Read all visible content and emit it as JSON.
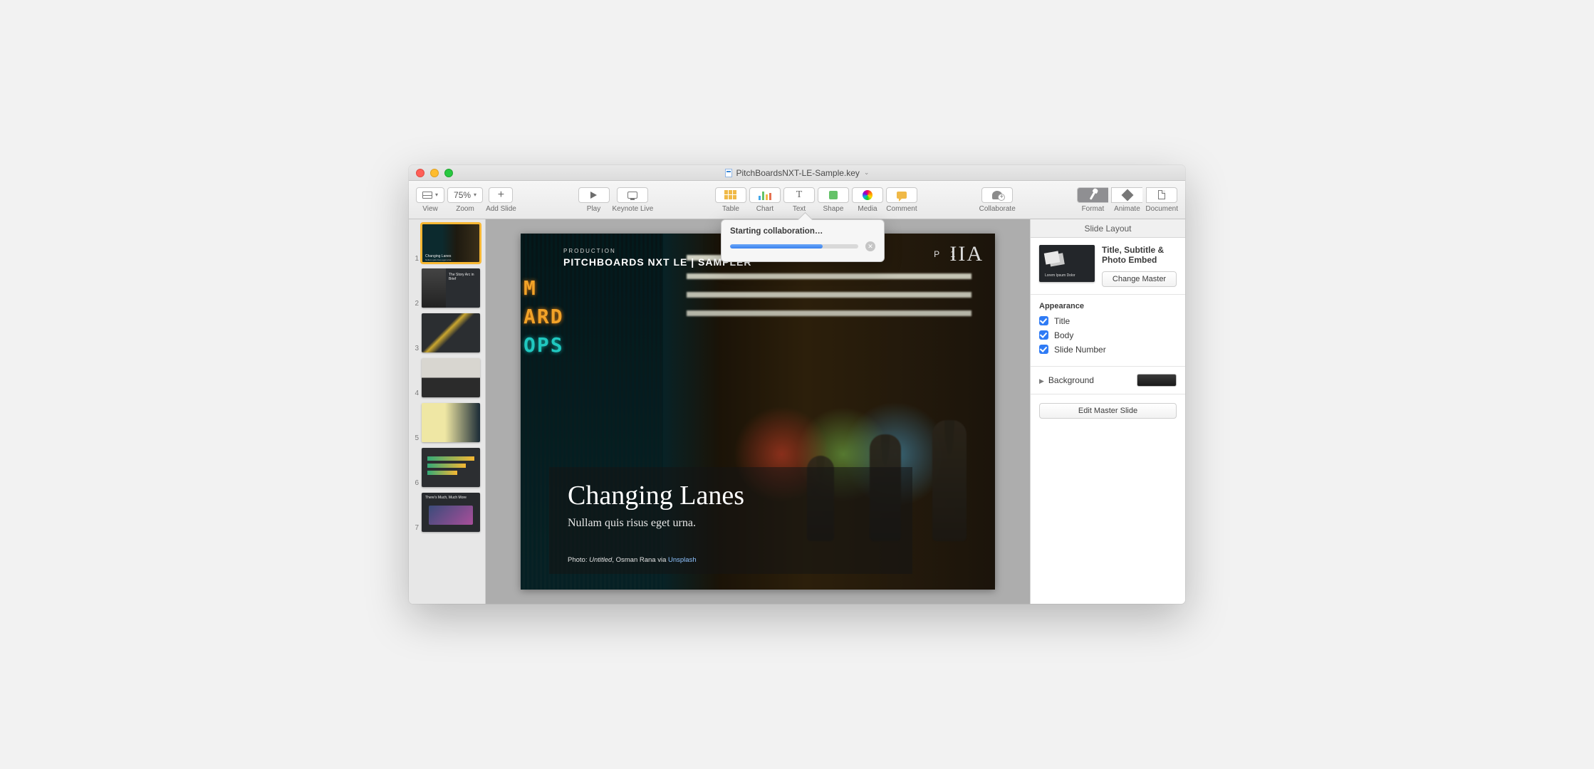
{
  "window": {
    "title": "PitchBoardsNXT-LE-Sample.key"
  },
  "toolbar": {
    "view": "View",
    "zoom_value": "75%",
    "zoom": "Zoom",
    "add_slide": "Add Slide",
    "play": "Play",
    "keynote_live": "Keynote Live",
    "table": "Table",
    "chart": "Chart",
    "text": "Text",
    "shape": "Shape",
    "media": "Media",
    "comment": "Comment",
    "collaborate": "Collaborate",
    "format": "Format",
    "animate": "Animate",
    "document": "Document"
  },
  "thumbnails": [
    {
      "n": "1",
      "title": "Changing Lanes",
      "sub": "Nullam quis risus eget urna"
    },
    {
      "n": "2",
      "title": "The Story Arc in Brief",
      "sub": ""
    },
    {
      "n": "3",
      "title": "",
      "sub": ""
    },
    {
      "n": "4",
      "title": "",
      "sub": ""
    },
    {
      "n": "5",
      "title": "",
      "sub": ""
    },
    {
      "n": "6",
      "title": "",
      "sub": ""
    },
    {
      "n": "7",
      "title": "There's Much, Much More",
      "sub": ""
    }
  ],
  "slide": {
    "overline": "PRODUCTION",
    "banner": "PITCHBOARDS NXT LE | SAMPLER",
    "page_prefix": "P",
    "page_num": "1",
    "roman": "IIA",
    "neon1": "M",
    "neon2": "ARD",
    "neon3": "OPS",
    "title": "Changing Lanes",
    "subtitle": "Nullam quis risus eget urna.",
    "credit_prefix": "Photo: ",
    "credit_title": "Untitled",
    "credit_mid": ", Osman Rana via ",
    "credit_link": "Unsplash"
  },
  "inspector": {
    "header": "Slide Layout",
    "layout_name": "Title, Subtitle & Photo Embed",
    "master_caption": "Lorem Ipsum Dolor",
    "change_master": "Change Master",
    "appearance": "Appearance",
    "title_chk": "Title",
    "body_chk": "Body",
    "slidenum_chk": "Slide Number",
    "background": "Background",
    "edit_master": "Edit Master Slide"
  },
  "collab": {
    "title": "Starting collaboration…",
    "cancel_glyph": "✕"
  }
}
